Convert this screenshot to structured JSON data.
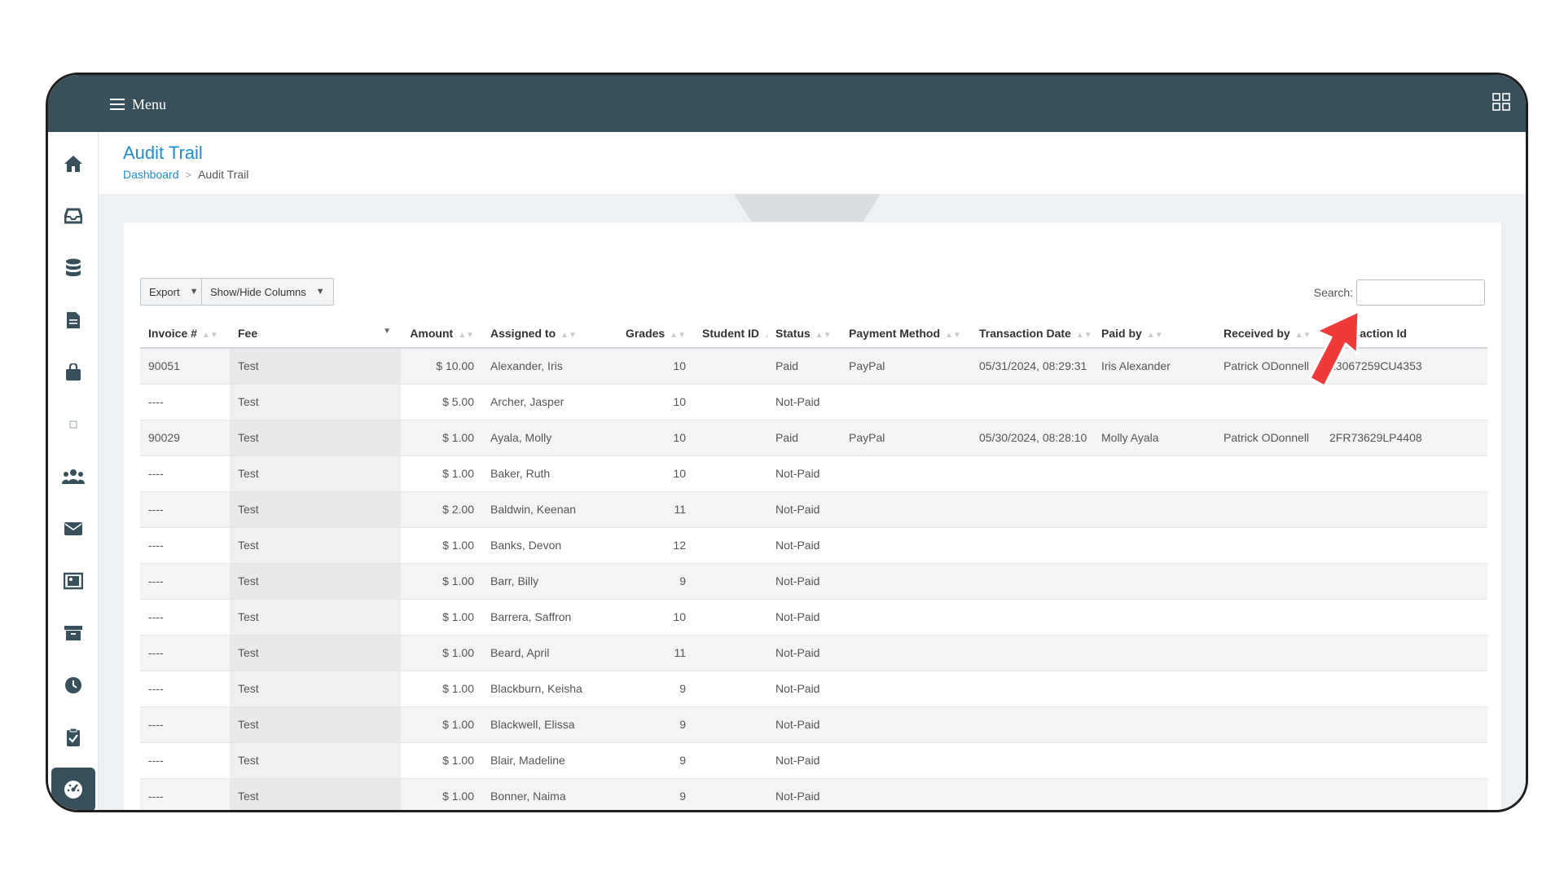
{
  "topbar": {
    "menu_label": "Menu"
  },
  "header": {
    "title": "Audit Trail",
    "breadcrumb": {
      "link": "Dashboard",
      "current": "Audit Trail"
    }
  },
  "toolbar": {
    "export_label": "Export",
    "columns_label": "Show/Hide Columns",
    "search_label": "Search:",
    "search_value": ""
  },
  "table": {
    "columns": [
      "Invoice #",
      "Fee",
      "Amount",
      "Assigned to",
      "Grades",
      "Student ID",
      "Status",
      "Payment Method",
      "Transaction Date",
      "Paid by",
      "Received by",
      "Transaction Id"
    ],
    "rows": [
      [
        "90051",
        "Test",
        "$ 10.00",
        "Alexander, Iris",
        "10",
        "",
        "Paid",
        "PayPal",
        "05/31/2024, 08:29:31",
        "Iris Alexander",
        "Patrick ODonnell",
        "13067259CU4353"
      ],
      [
        "----",
        "Test",
        "$ 5.00",
        "Archer, Jasper",
        "10",
        "",
        "Not-Paid",
        "",
        "",
        "",
        "",
        ""
      ],
      [
        "90029",
        "Test",
        "$ 1.00",
        "Ayala, Molly",
        "10",
        "",
        "Paid",
        "PayPal",
        "05/30/2024, 08:28:10",
        "Molly Ayala",
        "Patrick ODonnell",
        "2FR73629LP4408"
      ],
      [
        "----",
        "Test",
        "$ 1.00",
        "Baker, Ruth",
        "10",
        "",
        "Not-Paid",
        "",
        "",
        "",
        "",
        ""
      ],
      [
        "----",
        "Test",
        "$ 2.00",
        "Baldwin, Keenan",
        "11",
        "",
        "Not-Paid",
        "",
        "",
        "",
        "",
        ""
      ],
      [
        "----",
        "Test",
        "$ 1.00",
        "Banks, Devon",
        "12",
        "",
        "Not-Paid",
        "",
        "",
        "",
        "",
        ""
      ],
      [
        "----",
        "Test",
        "$ 1.00",
        "Barr, Billy",
        "9",
        "",
        "Not-Paid",
        "",
        "",
        "",
        "",
        ""
      ],
      [
        "----",
        "Test",
        "$ 1.00",
        "Barrera, Saffron",
        "10",
        "",
        "Not-Paid",
        "",
        "",
        "",
        "",
        ""
      ],
      [
        "----",
        "Test",
        "$ 1.00",
        "Beard, April",
        "11",
        "",
        "Not-Paid",
        "",
        "",
        "",
        "",
        ""
      ],
      [
        "----",
        "Test",
        "$ 1.00",
        "Blackburn, Keisha",
        "9",
        "",
        "Not-Paid",
        "",
        "",
        "",
        "",
        ""
      ],
      [
        "----",
        "Test",
        "$ 1.00",
        "Blackwell, Elissa",
        "9",
        "",
        "Not-Paid",
        "",
        "",
        "",
        "",
        ""
      ],
      [
        "----",
        "Test",
        "$ 1.00",
        "Blair, Madeline",
        "9",
        "",
        "Not-Paid",
        "",
        "",
        "",
        "",
        ""
      ],
      [
        "----",
        "Test",
        "$ 1.00",
        "Bonner, Naima",
        "9",
        "",
        "Not-Paid",
        "",
        "",
        "",
        "",
        ""
      ]
    ]
  },
  "sidebar": {
    "items": [
      {
        "icon": "home-icon"
      },
      {
        "icon": "inbox-icon"
      },
      {
        "icon": "database-icon"
      },
      {
        "icon": "document-icon"
      },
      {
        "icon": "briefcase-icon"
      },
      {
        "icon": "placeholder-icon"
      },
      {
        "icon": "users-icon"
      },
      {
        "icon": "envelope-icon"
      },
      {
        "icon": "gallery-icon"
      },
      {
        "icon": "archive-icon"
      },
      {
        "icon": "clock-icon"
      },
      {
        "icon": "clipboard-check-icon"
      },
      {
        "icon": "dashboard-gauge-icon"
      }
    ]
  },
  "colors": {
    "topbar": "#37505c",
    "accent": "#1a8fd6",
    "pointer": "#f03a3a"
  }
}
